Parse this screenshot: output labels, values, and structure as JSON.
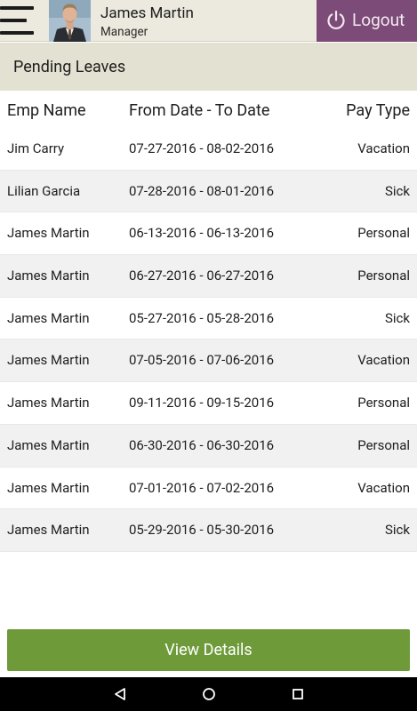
{
  "header": {
    "user_name": "James Martin",
    "user_role": "Manager",
    "logout_label": "Logout",
    "logout_color": "#7c4b78"
  },
  "section": {
    "title": "Pending Leaves"
  },
  "table": {
    "columns": [
      "Emp Name",
      "From Date - To Date",
      "Pay Type"
    ],
    "rows": [
      {
        "name": "Jim Carry",
        "dates": "07-27-2016 - 08-02-2016",
        "type": "Vacation"
      },
      {
        "name": "Lilian Garcia",
        "dates": "07-28-2016 - 08-01-2016",
        "type": "Sick"
      },
      {
        "name": "James Martin",
        "dates": "06-13-2016 - 06-13-2016",
        "type": "Personal"
      },
      {
        "name": "James Martin",
        "dates": "06-27-2016 - 06-27-2016",
        "type": "Personal"
      },
      {
        "name": "James Martin",
        "dates": "05-27-2016 - 05-28-2016",
        "type": "Sick"
      },
      {
        "name": "James Martin",
        "dates": "07-05-2016 - 07-06-2016",
        "type": "Vacation"
      },
      {
        "name": "James Martin",
        "dates": "09-11-2016 - 09-15-2016",
        "type": "Personal"
      },
      {
        "name": "James Martin",
        "dates": "06-30-2016 - 06-30-2016",
        "type": "Personal"
      },
      {
        "name": "James Martin",
        "dates": "07-01-2016 - 07-02-2016",
        "type": "Vacation"
      },
      {
        "name": "James Martin",
        "dates": "05-29-2016 - 05-30-2016",
        "type": "Sick"
      }
    ]
  },
  "footer": {
    "view_details_label": "View Details",
    "button_color": "#6e9a3a"
  },
  "icons": {
    "menu": "hamburger-icon",
    "logout": "power-icon",
    "back": "back-triangle-icon",
    "home": "home-circle-icon",
    "recent": "recent-apps-square-icon"
  }
}
